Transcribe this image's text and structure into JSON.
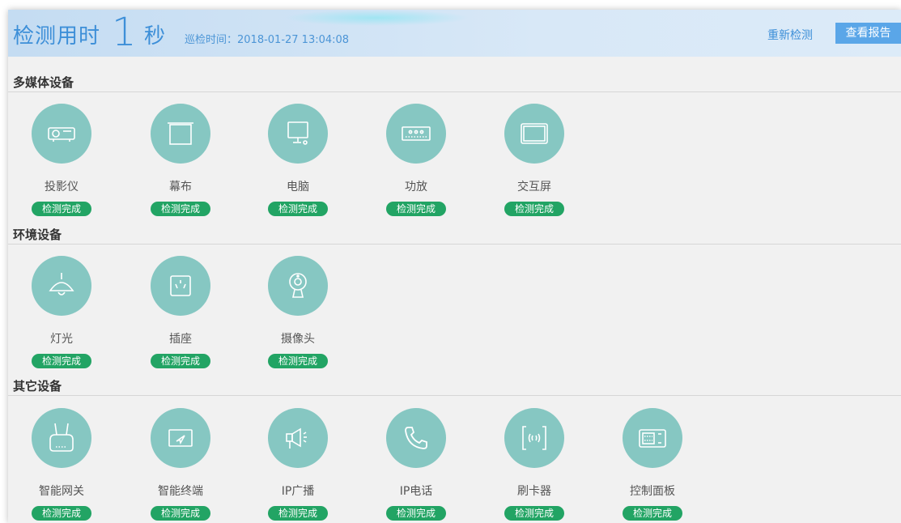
{
  "header": {
    "duration_label": "检测用时",
    "duration_value": "1",
    "duration_unit": "秒",
    "patrol_time": "巡检时间：2018-01-27 13:04:08",
    "recheck_label": "重新检测",
    "report_label": "查看报告"
  },
  "sections": [
    {
      "title": "多媒体设备",
      "devices": [
        {
          "name": "投影仪",
          "status": "检测完成",
          "icon": "projector-icon"
        },
        {
          "name": "幕布",
          "status": "检测完成",
          "icon": "screen-curtain-icon"
        },
        {
          "name": "电脑",
          "status": "检测完成",
          "icon": "computer-icon"
        },
        {
          "name": "功放",
          "status": "检测完成",
          "icon": "amplifier-icon"
        },
        {
          "name": "交互屏",
          "status": "检测完成",
          "icon": "interactive-screen-icon"
        }
      ]
    },
    {
      "title": "环境设备",
      "devices": [
        {
          "name": "灯光",
          "status": "检测完成",
          "icon": "lamp-icon"
        },
        {
          "name": "插座",
          "status": "检测完成",
          "icon": "socket-icon"
        },
        {
          "name": "摄像头",
          "status": "检测完成",
          "icon": "camera-icon"
        }
      ]
    },
    {
      "title": "其它设备",
      "devices": [
        {
          "name": "智能网关",
          "status": "检测完成",
          "icon": "gateway-icon"
        },
        {
          "name": "智能终端",
          "status": "检测完成",
          "icon": "terminal-icon"
        },
        {
          "name": "IP广播",
          "status": "检测完成",
          "icon": "broadcast-icon"
        },
        {
          "name": "IP电话",
          "status": "检测完成",
          "icon": "phone-icon"
        },
        {
          "name": "刷卡器",
          "status": "检测完成",
          "icon": "card-reader-icon"
        },
        {
          "name": "控制面板",
          "status": "检测完成",
          "icon": "control-panel-icon"
        }
      ]
    }
  ],
  "colors": {
    "accent": "#3d8fd8",
    "icon_circle": "#86c7c2",
    "status_badge": "#22a464"
  }
}
